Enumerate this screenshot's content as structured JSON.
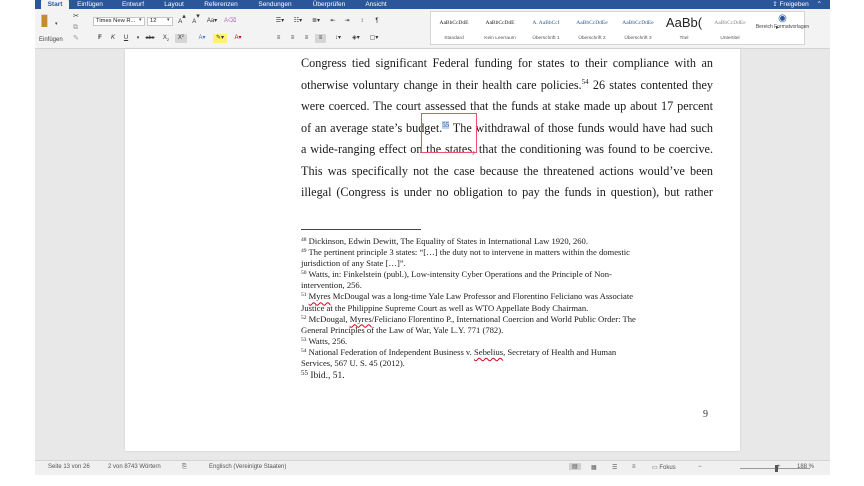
{
  "ribbon": {
    "tabs": [
      "Start",
      "Einfügen",
      "Entwurf",
      "Layout",
      "Referenzen",
      "Sendungen",
      "Überprüfen",
      "Ansicht"
    ],
    "active_tab": "Start",
    "share_label": "Freigeben",
    "paste_label": "Einfügen",
    "font_name": "Times New R...",
    "font_size": "12",
    "styles": [
      {
        "preview": "AaBbCcDdE",
        "name": "Standard"
      },
      {
        "preview": "AaBbCcDdE",
        "name": "Kein Leerraum"
      },
      {
        "preview": "A. AaBbCcI",
        "name": "Überschrift 1"
      },
      {
        "preview": "AaBbCcDdEe",
        "name": "Überschrift 2"
      },
      {
        "preview": "AaBbCcDdEe",
        "name": "Überschrift 3"
      },
      {
        "preview": "AaBb(",
        "name": "Titel"
      },
      {
        "preview": "AaBbCcDdEe",
        "name": "Untertitel"
      }
    ],
    "styles_pane_label": "Bereich Formatvorlagen"
  },
  "document": {
    "body_lines": [
      "Congress tied significant Federal funding for states to their compliance with an",
      "otherwise voluntary change in their health care policies.",
      "were coerced. The court assessed that the funds at stake made up about 17 percent",
      "of an average state’s budget.",
      "a wide-ranging effect on the states, that the conditioning was found to be coercive.",
      "This was specifically not the case because the threatened actions would’ve been",
      "illegal (Congress is under no obligation to pay the funds in question), but rather"
    ],
    "line2_sup": "54",
    "line2_tail": " 26 states contented they",
    "line4_sup": "55",
    "line4_tail": " The withdrawal of those funds would have had such",
    "footnotes": [
      {
        "num": "48",
        "text": "Dickinson, Edwin Dewitt, The Equality of States in International Law 1920, 260."
      },
      {
        "num": "49",
        "text": "The pertinent principle 3 states: “[…] the duty not to intervene in matters within the domestic"
      },
      {
        "num": "",
        "text": "jurisdiction of any State […]”."
      },
      {
        "num": "50",
        "text": "Watts, in: Finkelstein (publ.), Low-intensity Cyber Operations and the Principle of Non-"
      },
      {
        "num": "",
        "text": "intervention, 256."
      },
      {
        "num": "51",
        "text": "Myres McDougal was a long-time Yale Law Professor and Florentino Feliciano was Associate"
      },
      {
        "num": "",
        "text": "Justice at the Philippine Supreme Court as well as WTO Appellate Body Chairman."
      },
      {
        "num": "52",
        "text": "McDougal, Myres/Feliciano Florentino P., International Coercion and World Public Order: The"
      },
      {
        "num": "",
        "text": "General Principles of the Law of War, Yale L.Y. 771 (782)."
      },
      {
        "num": "53",
        "text": "Watts, 256."
      },
      {
        "num": "54",
        "text": "National Federation of Independent Business v. Sebelius, Secretary of Health and Human"
      },
      {
        "num": "",
        "text": "Services, 567 U. S. 45 (2012)."
      },
      {
        "num": "55",
        "text": "Ibid., 51."
      }
    ],
    "page_number": "9"
  },
  "status": {
    "page": "Seite 13 von 26",
    "words": "2 von 8743 Wörtern",
    "language": "Englisch (Vereinigte Staaten)",
    "focus": "Fokus",
    "zoom": "188 %",
    "zoom_fraction": 0.5
  },
  "colors": {
    "accent": "#2b579a",
    "selection_box": "#e8506b",
    "highlight": "#bcd4f0"
  }
}
